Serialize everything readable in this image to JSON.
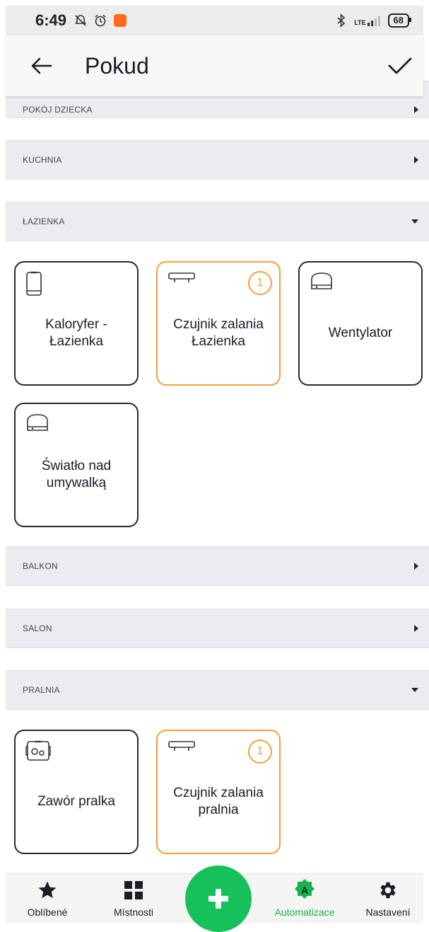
{
  "status_bar": {
    "time": "6:49",
    "lte": "LTE",
    "battery": "68"
  },
  "header": {
    "title": "Pokud"
  },
  "sections": [
    {
      "label": "POKÓJ DZIECKA",
      "state": "collapsed"
    },
    {
      "label": "KUCHNIA",
      "state": "collapsed"
    },
    {
      "label": "ŁAZIENKA",
      "state": "expanded"
    },
    {
      "label": "BALKON",
      "state": "collapsed"
    },
    {
      "label": "SALON",
      "state": "collapsed"
    },
    {
      "label": "PRALNIA",
      "state": "expanded"
    }
  ],
  "lazienka_devices": [
    {
      "label": "Kaloryfer -\nŁazienka",
      "icon": "radiator-icon",
      "badge": null
    },
    {
      "label": "Czujnik zalania\nŁazienka",
      "icon": "flood-sensor-icon",
      "badge": "1"
    },
    {
      "label": "Wentylator",
      "icon": "relay-module-icon",
      "badge": null
    },
    {
      "label": "Światło nad\numywalką",
      "icon": "relay-module-icon",
      "badge": null
    }
  ],
  "pralnia_devices": [
    {
      "label": "Zawór pralka",
      "icon": "valve-icon",
      "badge": null
    },
    {
      "label": "Czujnik zalania\npralnia",
      "icon": "flood-sensor-icon",
      "badge": "1"
    }
  ],
  "bottom_nav": {
    "items": [
      {
        "label": "Oblíbené",
        "icon": "star-icon"
      },
      {
        "label": "Místnosti",
        "icon": "grid-icon"
      },
      {
        "label": "Automatizace",
        "icon": "automation-icon",
        "active": true
      },
      {
        "label": "Nastavení",
        "icon": "gear-icon"
      }
    ],
    "fab_icon": "plus-icon"
  },
  "colors": {
    "accent": "#16C15A",
    "highlight_border": "#F2A03A",
    "section_bg": "#ECECF0"
  }
}
